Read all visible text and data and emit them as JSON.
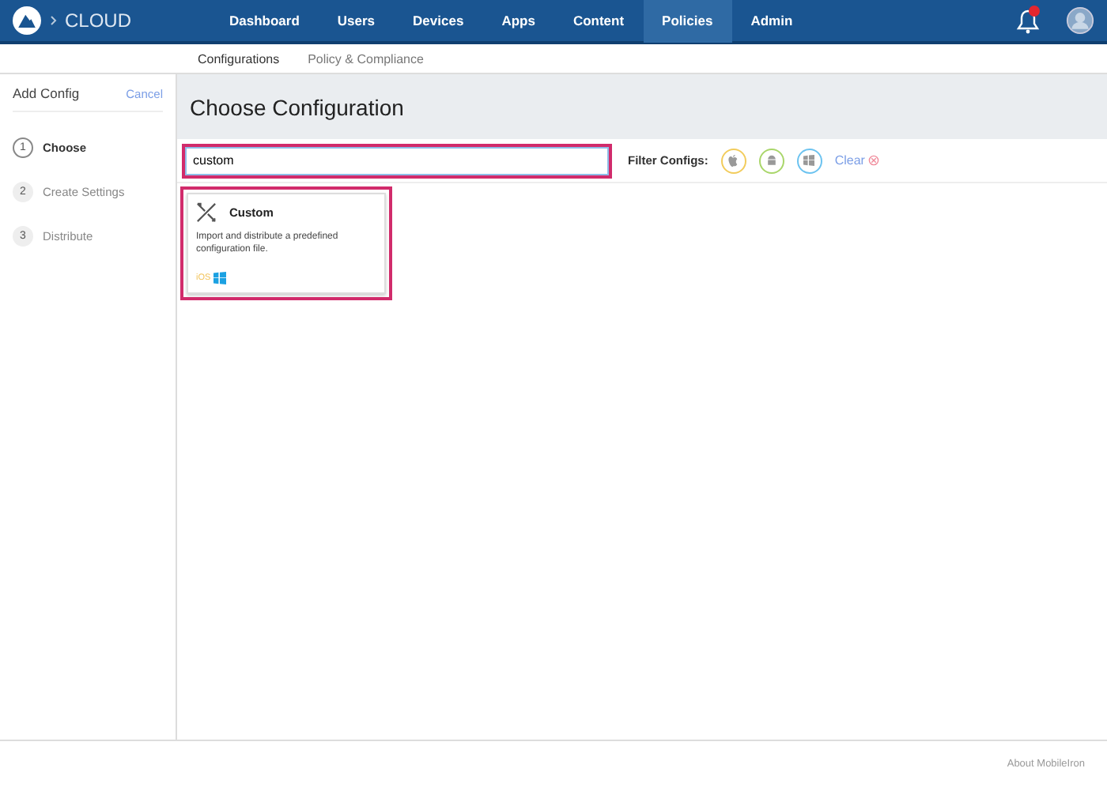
{
  "brand": {
    "name": "CLOUD"
  },
  "nav": [
    {
      "label": "Dashboard",
      "selected": false
    },
    {
      "label": "Users",
      "selected": false
    },
    {
      "label": "Devices",
      "selected": false
    },
    {
      "label": "Apps",
      "selected": false
    },
    {
      "label": "Content",
      "selected": false
    },
    {
      "label": "Policies",
      "selected": true
    },
    {
      "label": "Admin",
      "selected": false
    }
  ],
  "notifications": {
    "alert": true
  },
  "subnav": [
    {
      "label": "Configurations",
      "selected": true
    },
    {
      "label": "Policy & Compliance",
      "selected": false
    }
  ],
  "sidebar": {
    "title": "Add Config",
    "cancel": "Cancel",
    "steps": [
      {
        "number": "1",
        "label": "Choose",
        "selected": true
      },
      {
        "number": "2",
        "label": "Create Settings",
        "selected": false
      },
      {
        "number": "3",
        "label": "Distribute",
        "selected": false
      }
    ]
  },
  "main": {
    "title": "Choose Configuration",
    "search": {
      "value": "custom",
      "highlighted": true
    },
    "filter_label": "Filter Configs:",
    "filters": [
      {
        "kind": "apple",
        "color": "#f2cc5c"
      },
      {
        "kind": "android",
        "color": "#a9d66a"
      },
      {
        "kind": "windows",
        "color": "#6cc3f0"
      }
    ],
    "clear": "Clear",
    "cards": [
      {
        "title": "Custom",
        "description": "Import and distribute a predefined configuration file.",
        "platform": "iOS",
        "highlighted": true
      }
    ]
  },
  "footer": {
    "link": "About MobileIron"
  }
}
